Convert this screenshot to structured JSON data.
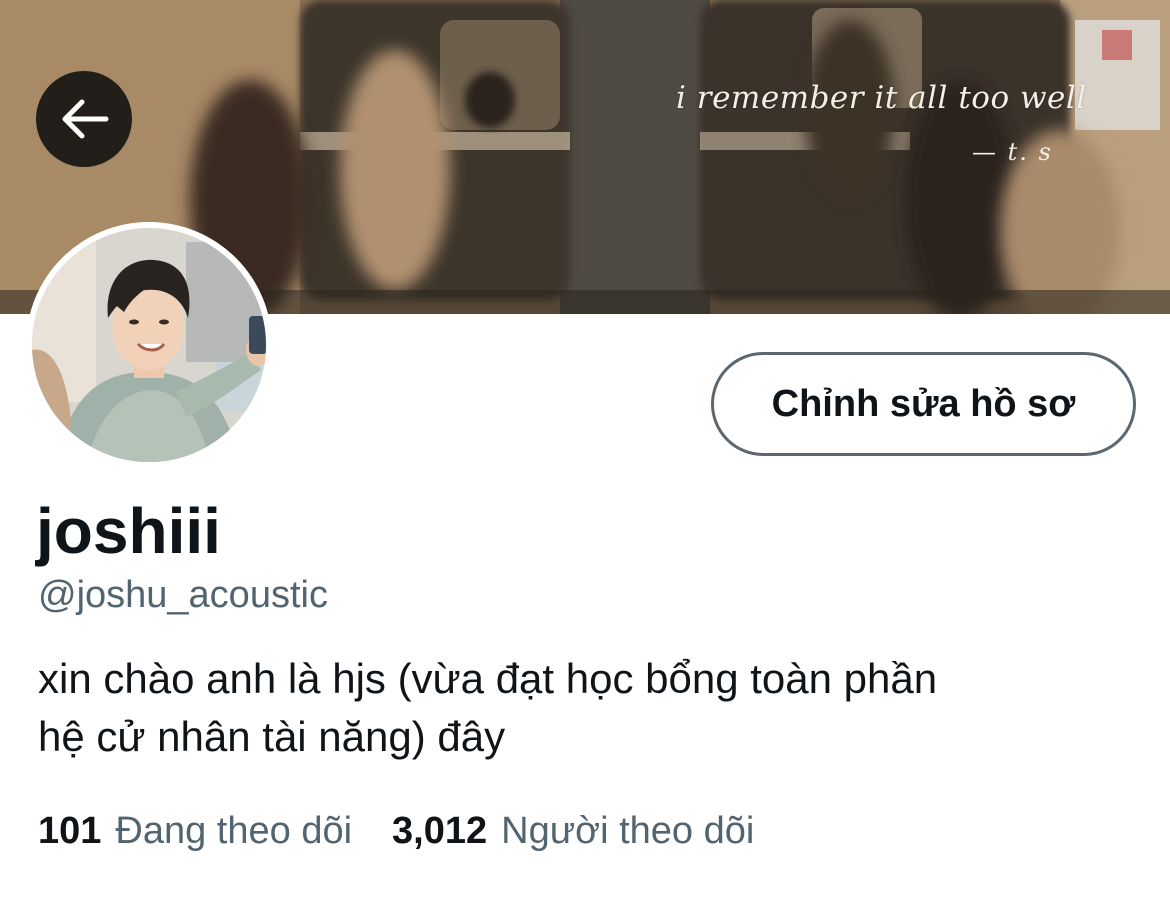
{
  "banner": {
    "quote": "i remember it all too well",
    "attribution": "— t. s"
  },
  "nav": {
    "back_icon": "arrow-left-icon"
  },
  "profile": {
    "edit_button_label": "Chỉnh sửa hồ sơ",
    "display_name": "joshiii",
    "handle": "@joshu_acoustic",
    "bio_lines": [
      "xin chào anh là hjs (vừa đạt học bổng toàn phần",
      "hệ cử nhân tài năng) đây"
    ]
  },
  "stats": {
    "following_count": "101",
    "following_label": "Đang theo dõi",
    "followers_count": "3,012",
    "followers_label": "Người theo dõi"
  },
  "colors": {
    "primary_text": "#0f1419",
    "secondary_text": "#536471",
    "button_border": "#5c6770"
  }
}
